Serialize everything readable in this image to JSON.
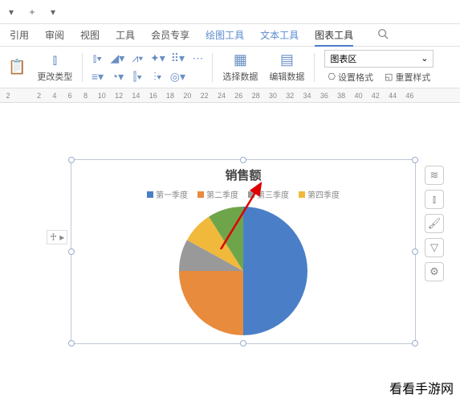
{
  "tabs": {
    "dropdown": "▾",
    "plus": "+",
    "more": "▾"
  },
  "menu": {
    "items": [
      "引用",
      "审阅",
      "视图",
      "工具",
      "会员专享",
      "绘图工具",
      "文本工具",
      "图表工具"
    ],
    "active_index": 7,
    "accent_indices": [
      5,
      6,
      7
    ]
  },
  "toolbar": {
    "change_type": "更改类型",
    "select_data": "选择数据",
    "edit_data": "编辑数据",
    "chart_area_select": "图表区",
    "set_format": "设置格式",
    "reset_style": "重置样式"
  },
  "ruler_marks": [
    "2",
    "",
    "2",
    "4",
    "6",
    "8",
    "10",
    "12",
    "14",
    "16",
    "18",
    "20",
    "22",
    "24",
    "26",
    "28",
    "30",
    "32",
    "34",
    "36",
    "38",
    "40",
    "42",
    "44",
    "46"
  ],
  "side_icons": [
    "≋",
    "⫾",
    "🖌",
    "▽",
    "⚙"
  ],
  "vruler": "♰ ▸",
  "chart_data": {
    "type": "pie",
    "title": "销售额",
    "series_names": [
      "第一季度",
      "第二季度",
      "第三季度",
      "第四季度"
    ],
    "colors": [
      "#4a7fc7",
      "#e88b3d",
      "#999999",
      "#f1b93c",
      "#6fa54a"
    ],
    "values": [
      50,
      25,
      8,
      8,
      9
    ]
  },
  "watermark": "看看手游网"
}
